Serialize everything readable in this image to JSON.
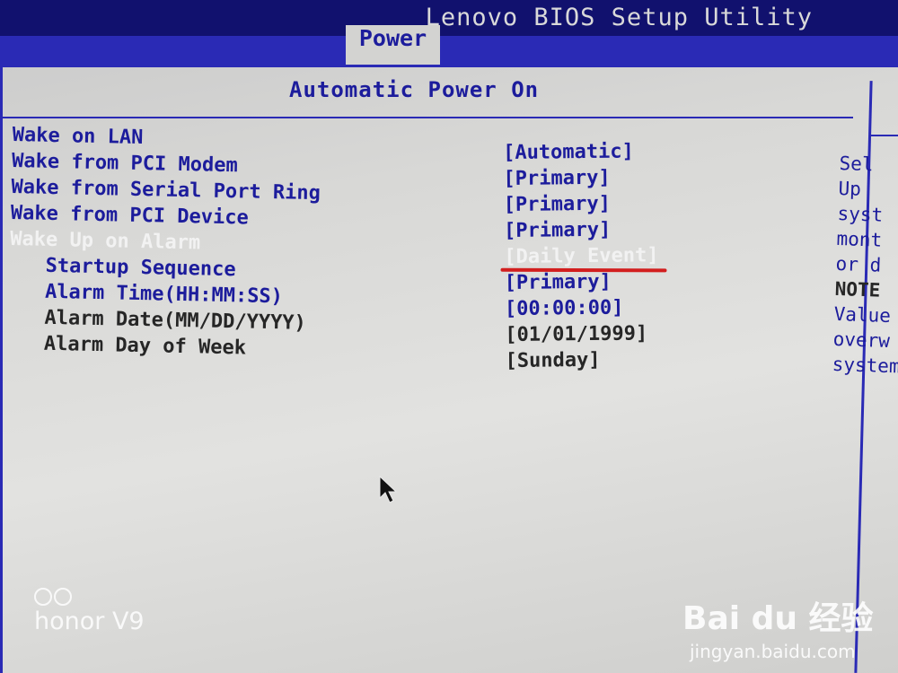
{
  "app": {
    "title": "Lenovo BIOS Setup Utility",
    "active_tab": "Power"
  },
  "menu": {
    "header": "Automatic Power On",
    "items": [
      {
        "label": "Wake on LAN",
        "value": "[Automatic]"
      },
      {
        "label": "Wake from PCI Modem",
        "value": "[Primary]"
      },
      {
        "label": "Wake from Serial Port Ring",
        "value": "[Primary]"
      },
      {
        "label": "Wake from PCI Device",
        "value": "[Primary]"
      },
      {
        "label": "Wake Up on Alarm",
        "value": "[Daily Event]",
        "selected": true
      },
      {
        "label": "Startup Sequence",
        "value": "[Primary]"
      },
      {
        "label": "Alarm Time(HH:MM:SS)",
        "value": "[00:00:00]"
      },
      {
        "label": "Alarm Date(MM/DD/YYYY)",
        "value": "[01/01/1999]"
      },
      {
        "label": "Alarm Day of Week",
        "value": "[Sunday]"
      }
    ]
  },
  "help": {
    "lines": [
      "Sel",
      "Up",
      "syst",
      "mont",
      "or d",
      "NOTE",
      "Value",
      "overw",
      "system"
    ]
  },
  "watermarks": {
    "camera": "honor V9",
    "site_brand": "Bai du 经验",
    "site_url": "jingyan.baidu.com"
  },
  "colors": {
    "bios_blue": "#1c1c9c",
    "selected_text": "#f2f2f2",
    "annotation_red": "#d21e1e"
  }
}
